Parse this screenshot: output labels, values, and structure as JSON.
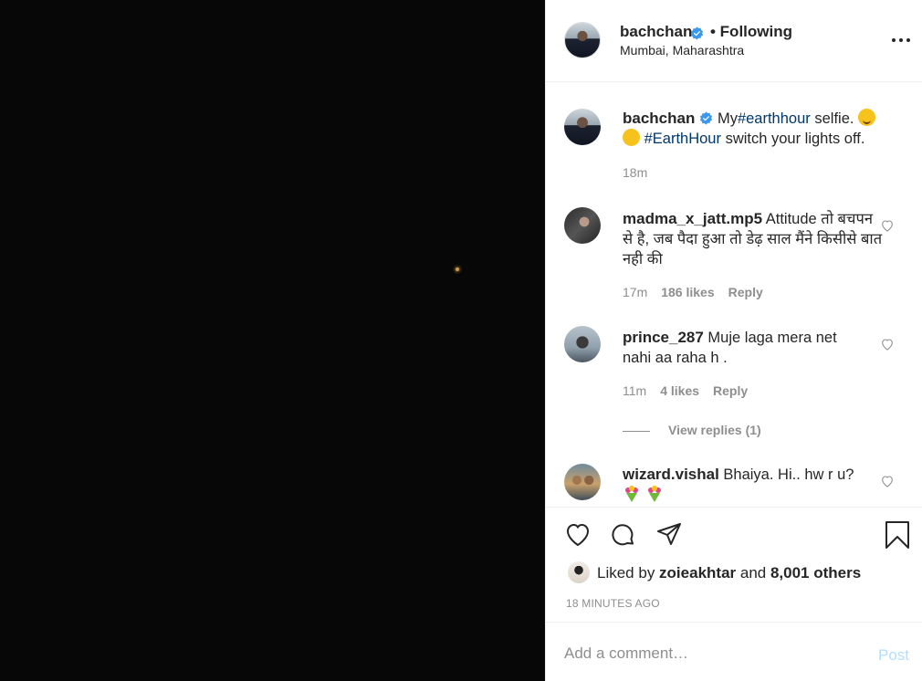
{
  "colors": {
    "photo_bg": "#070707",
    "verified": "#3897f0",
    "link": "#00376b",
    "muted": "#8e8e8e",
    "post_disabled": "#b2dffc"
  },
  "header": {
    "username": "bachchan",
    "separator": "• Following",
    "location": "Mumbai, Maharashtra"
  },
  "caption": {
    "username": "bachchan",
    "text_before": "My",
    "hashtag1": "#earthhour",
    "text_mid": " selfie. ",
    "hashtag2": "#EarthHour",
    "text_after": " switch your lights off.",
    "time": "18m"
  },
  "comments": [
    {
      "username": "madma_x_jatt.mp5",
      "text": " Attitude तो बचपन से है, जब पैदा हुआ तो डेढ़ साल मैंने किसीसे बात नही की",
      "time": "17m",
      "likes": "186 likes",
      "reply": "Reply"
    },
    {
      "username": "prince_287",
      "text": " Muje laga mera net nahi aa raha h .",
      "time": "11m",
      "likes": "4 likes",
      "reply": "Reply",
      "view_replies": "View replies (1)"
    },
    {
      "username": "wizard.vishal",
      "text": " Bhaiya. Hi.. hw r u?"
    }
  ],
  "likes": {
    "prefix": "Liked by ",
    "user": "zoieakhtar",
    "and": " and ",
    "others": "8,001 others"
  },
  "timestamp": "18 MINUTES AGO",
  "add_comment": {
    "placeholder": "Add a comment…",
    "post_label": "Post"
  },
  "icons": [
    "more-icon",
    "verified-icon",
    "heart-icon",
    "comment-icon",
    "share-icon",
    "bookmark-icon"
  ]
}
